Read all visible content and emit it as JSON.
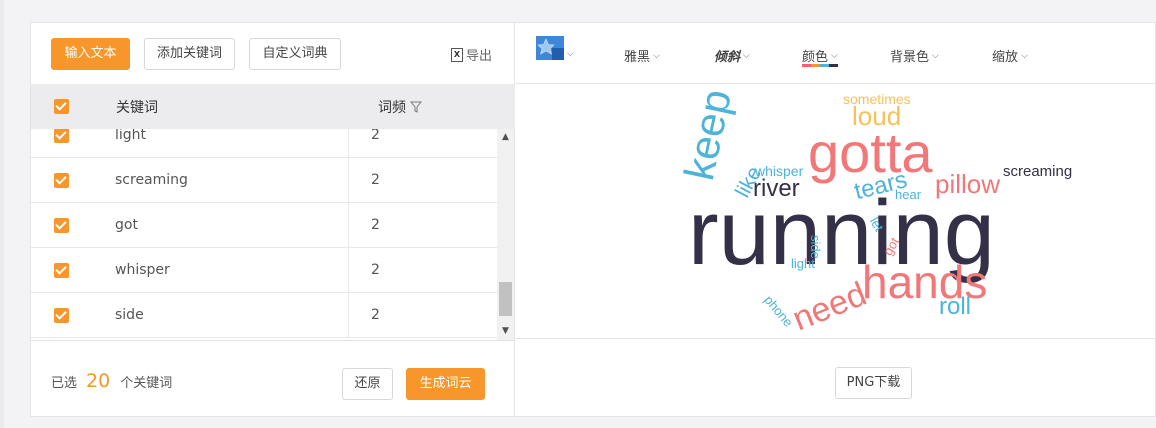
{
  "left_toolbar": {
    "input_text": "输入文本",
    "add_keyword": "添加关键词",
    "custom_dict": "自定义词典",
    "export_icon": "excel-icon",
    "export": "导出"
  },
  "table": {
    "col_keyword": "关键词",
    "col_freq": "词频",
    "rows": [
      {
        "keyword": "light",
        "freq": "2"
      },
      {
        "keyword": "screaming",
        "freq": "2"
      },
      {
        "keyword": "got",
        "freq": "2"
      },
      {
        "keyword": "whisper",
        "freq": "2"
      },
      {
        "keyword": "side",
        "freq": "2"
      }
    ]
  },
  "footer_left": {
    "selected_prefix": "已选",
    "selected_count": "20",
    "selected_suffix": "个关键词",
    "reset": "还原",
    "generate": "生成词云"
  },
  "right_toolbar": {
    "shape_icon": "star-shape-icon",
    "font": "雅黑",
    "style": "倾斜",
    "color": "颜色",
    "background": "背景色",
    "zoom": "缩放",
    "color_strip": [
      "#f0636a",
      "#f7962b",
      "#4db3d9",
      "#333048"
    ]
  },
  "cloud_words": [
    {
      "text": "running",
      "color": "#333048"
    },
    {
      "text": "gotta",
      "color": "#f27778"
    },
    {
      "text": "hands",
      "color": "#f27778"
    },
    {
      "text": "keep",
      "color": "#4db3d9"
    },
    {
      "text": "loud",
      "color": "#f8c158"
    },
    {
      "text": "sometimes",
      "color": "#f8c158"
    },
    {
      "text": "pillow",
      "color": "#f27778"
    },
    {
      "text": "river",
      "color": "#333048"
    },
    {
      "text": "tears",
      "color": "#4db3d9"
    },
    {
      "text": "need",
      "color": "#f27778"
    },
    {
      "text": "roll",
      "color": "#4db3d9"
    },
    {
      "text": "like",
      "color": "#4db3d9"
    },
    {
      "text": "whisper",
      "color": "#4db3d9"
    },
    {
      "text": "screaming",
      "color": "#333048"
    },
    {
      "text": "hear",
      "color": "#4db3d9"
    },
    {
      "text": "let",
      "color": "#4db3d9"
    },
    {
      "text": "got",
      "color": "#f27778"
    },
    {
      "text": "side",
      "color": "#4db3d9"
    },
    {
      "text": "light",
      "color": "#4db3d9"
    },
    {
      "text": "phone",
      "color": "#4db3d9"
    }
  ],
  "footer_right": {
    "download": "PNG下载"
  }
}
